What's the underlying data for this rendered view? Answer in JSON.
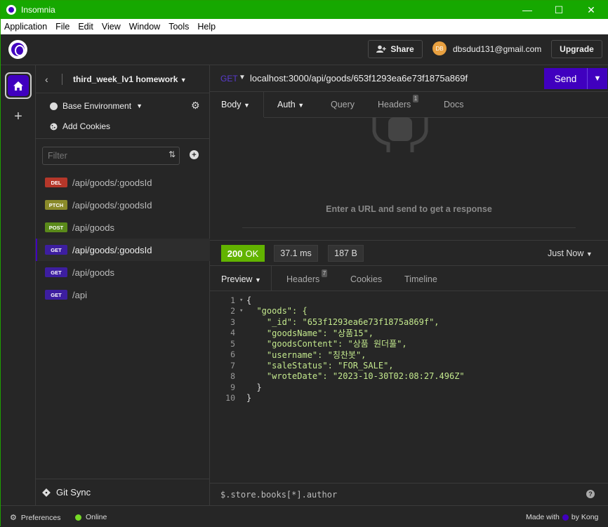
{
  "window": {
    "title": "Insomnia",
    "minimize": "—",
    "maximize": "☐",
    "close": "✕"
  },
  "menu": [
    "Application",
    "File",
    "Edit",
    "View",
    "Window",
    "Tools",
    "Help"
  ],
  "topbar": {
    "share_label": "Share",
    "avatar_initials": "DB",
    "email": "dbsdud131@gmail.com",
    "upgrade_label": "Upgrade"
  },
  "sidebar": {
    "project_name": "third_week_lv1 homework",
    "environment": "Base Environment",
    "add_cookies": "Add Cookies",
    "filter_placeholder": "Filter",
    "requests": [
      {
        "method": "DEL",
        "path": "/api/goods/:goodsId",
        "color": "#b5372a"
      },
      {
        "method": "PTCH",
        "path": "/api/goods/:goodsId",
        "color": "#8a8a2a"
      },
      {
        "method": "POST",
        "path": "/api/goods",
        "color": "#5a8a1a"
      },
      {
        "method": "GET",
        "path": "/api/goods/:goodsId",
        "color": "#3d1ea0"
      },
      {
        "method": "GET",
        "path": "/api/goods",
        "color": "#3d1ea0"
      },
      {
        "method": "GET",
        "path": "/api",
        "color": "#3d1ea0"
      }
    ],
    "git_sync": "Git Sync"
  },
  "request": {
    "method": "GET",
    "url": "localhost:3000/api/goods/653f1293ea6e73f1875a869f",
    "send_label": "Send",
    "tabs": {
      "body": "Body",
      "auth": "Auth",
      "query": "Query",
      "headers": "Headers",
      "headers_count": "1",
      "docs": "Docs"
    }
  },
  "response": {
    "empty_message": "Enter a URL and send to get a response",
    "status_code": "200",
    "status_text": "OK",
    "time": "37.1 ms",
    "size": "187 B",
    "history": "Just Now",
    "tabs": {
      "preview": "Preview",
      "headers": "Headers",
      "headers_count": "7",
      "cookies": "Cookies",
      "timeline": "Timeline"
    },
    "lines": [
      {
        "n": "1",
        "fold": "▾",
        "text": "{"
      },
      {
        "n": "2",
        "fold": "▾",
        "text": "  \"goods\": {"
      },
      {
        "n": "3",
        "fold": "",
        "text": "    \"_id\": \"653f1293ea6e73f1875a869f\","
      },
      {
        "n": "4",
        "fold": "",
        "text": "    \"goodsName\": \"상품15\","
      },
      {
        "n": "5",
        "fold": "",
        "text": "    \"goodsContent\": \"상품 원더풀\","
      },
      {
        "n": "6",
        "fold": "",
        "text": "    \"username\": \"칭찬봇\","
      },
      {
        "n": "7",
        "fold": "",
        "text": "    \"saleStatus\": \"FOR_SALE\","
      },
      {
        "n": "8",
        "fold": "",
        "text": "    \"wroteDate\": \"2023-10-30T02:08:27.496Z\""
      },
      {
        "n": "9",
        "fold": "",
        "text": "  }"
      },
      {
        "n": "10",
        "fold": "",
        "text": "}"
      }
    ],
    "jsonpath_placeholder": "$.store.books[*].author"
  },
  "statusbar": {
    "preferences": "Preferences",
    "online": "Online",
    "made_with": "Made with",
    "by_kong": "by Kong"
  }
}
